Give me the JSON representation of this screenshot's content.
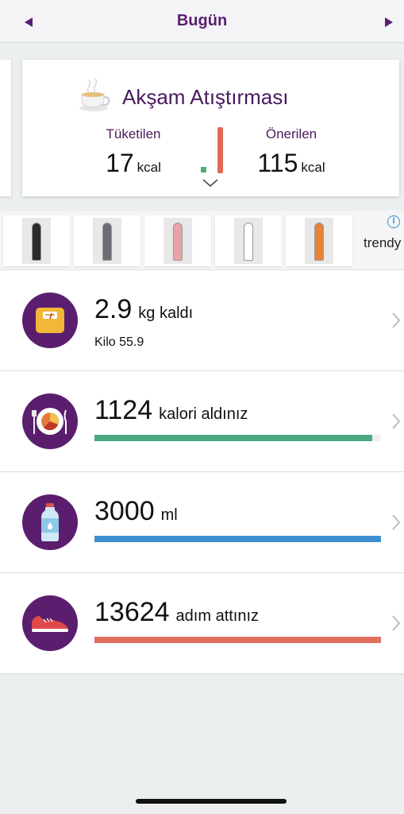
{
  "header": {
    "title": "Bugün"
  },
  "meal_card": {
    "title": "Akşam Atıştırması",
    "consumed_label": "Tüketilen",
    "consumed_value": "17",
    "consumed_unit": "kcal",
    "recommended_label": "Önerilen",
    "recommended_value": "115",
    "recommended_unit": "kcal",
    "icon": "tea-cup-icon"
  },
  "ad": {
    "brand_text": "trendy",
    "thumbnails": [
      {
        "outfit_color": "#2b2b2b"
      },
      {
        "outfit_color": "#6b6f73"
      },
      {
        "outfit_color": "#e9a3a8"
      },
      {
        "outfit_color": "#ffffff"
      },
      {
        "outfit_color": "#e7823a"
      }
    ]
  },
  "rows": {
    "weight": {
      "value": "2.9",
      "unit": "kg kaldı",
      "sub": "Kilo 55.9",
      "icon": "scale-icon"
    },
    "calories": {
      "value": "1124",
      "unit": "kalori aldınız",
      "progress": 0.97,
      "color": "#4aaa80",
      "icon": "plate-icon"
    },
    "water": {
      "value": "3000",
      "unit": "ml",
      "progress": 1.0,
      "color": "#3f8fd0",
      "icon": "water-bottle-icon"
    },
    "steps": {
      "value": "13624",
      "unit": "adım attınız",
      "progress": 1.0,
      "color": "#e07060",
      "icon": "sneaker-icon"
    }
  }
}
